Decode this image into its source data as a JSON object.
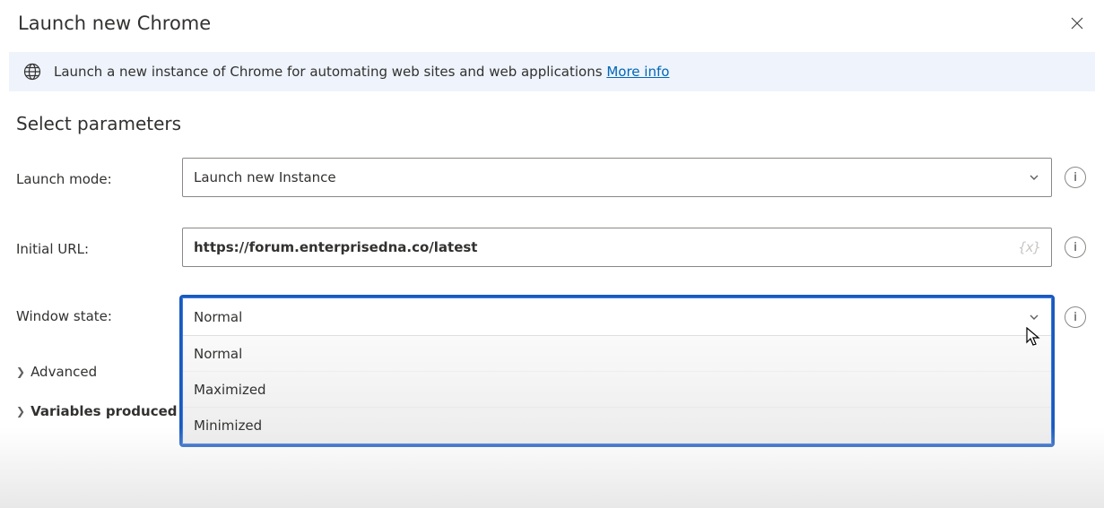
{
  "header": {
    "title": "Launch new Chrome"
  },
  "info": {
    "text": "Launch a new instance of Chrome for automating web sites and web applications ",
    "link": "More info"
  },
  "section_title": "Select parameters",
  "params": {
    "launch_mode": {
      "label": "Launch mode:",
      "value": "Launch new Instance"
    },
    "initial_url": {
      "label": "Initial URL:",
      "value": "https://forum.enterprisedna.co/latest",
      "var_token": "{x}"
    },
    "window_state": {
      "label": "Window state:",
      "selected": "Normal",
      "options": [
        "Normal",
        "Maximized",
        "Minimized"
      ]
    }
  },
  "collapsibles": {
    "advanced": "Advanced",
    "variables": "Variables produced"
  }
}
